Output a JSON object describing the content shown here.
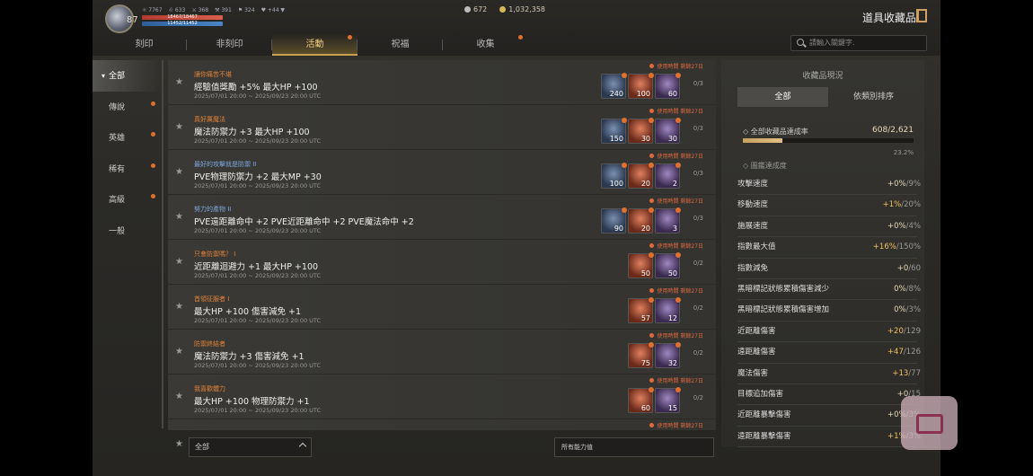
{
  "player": {
    "level": "87",
    "stats": [
      "⚛ 7767",
      "♌ 633",
      "⚔ 368",
      "⚒ 391",
      "⚑ 324",
      "♥ +44 ▼"
    ],
    "hp_text": "18467/18467",
    "mp_text": "11452/11452"
  },
  "currency": {
    "diamond": "672",
    "gold": "1,032,358",
    "diamond_color": "#bbbbbb",
    "gold_color": "#d6b85a"
  },
  "header": {
    "title": "道具收藏品"
  },
  "tabs": [
    {
      "label": "刻印",
      "active": false,
      "badge": false
    },
    {
      "label": "非刻印",
      "active": false,
      "badge": false
    },
    {
      "label": "活動",
      "active": true,
      "badge": true
    },
    {
      "label": "祝福",
      "active": false,
      "badge": false
    },
    {
      "label": "收集",
      "active": false,
      "badge": true
    }
  ],
  "search": {
    "placeholder": "請輸入關鍵字."
  },
  "sidebar": {
    "items": [
      {
        "label": "全部",
        "active": true,
        "badge": false
      },
      {
        "label": "傳說",
        "active": false,
        "badge": true
      },
      {
        "label": "英雄",
        "active": false,
        "badge": true
      },
      {
        "label": "稀有",
        "active": false,
        "badge": true
      },
      {
        "label": "高級",
        "active": false,
        "badge": true
      },
      {
        "label": "一般",
        "active": false,
        "badge": false
      }
    ]
  },
  "collections": [
    {
      "category": "讓你痛苦不堪",
      "cat_color": "orange",
      "desc": "經驗值獎勵 +5% 最大HP +100",
      "date": "2025/07/01 20:00 ~ 2025/09/23 20:00 UTC",
      "time": "使用時間 剩餘27日",
      "progress": "0/3",
      "items": [
        {
          "color": "blue",
          "num": "240"
        },
        {
          "color": "orange",
          "num": "100"
        },
        {
          "color": "purple",
          "num": "60"
        }
      ]
    },
    {
      "category": "真好厲魔法",
      "cat_color": "orange",
      "desc": "魔法防禦力 +3 最大HP +100",
      "date": "2025/07/01 20:00 ~ 2025/09/23 20:00 UTC",
      "time": "使用時間 剩餘27日",
      "progress": "0/3",
      "items": [
        {
          "color": "blue",
          "num": "150"
        },
        {
          "color": "orange",
          "num": "30"
        },
        {
          "color": "purple",
          "num": "30"
        }
      ]
    },
    {
      "category": "最好的攻擊就是防禦 II",
      "cat_color": "blue",
      "desc": "PVE物理防禦力 +2 最大MP +30",
      "date": "2025/07/01 20:00 ~ 2025/09/23 20:00 UTC",
      "time": "使用時間 剩餘27日",
      "progress": "0/3",
      "items": [
        {
          "color": "blue",
          "num": "100"
        },
        {
          "color": "orange",
          "num": "20"
        },
        {
          "color": "purple",
          "num": "2"
        }
      ]
    },
    {
      "category": "努力的產物 II",
      "cat_color": "blue",
      "desc": "PVE遠距離命中 +2 PVE近距離命中 +2 PVE魔法命中 +2",
      "date": "2025/07/01 20:00 ~ 2025/09/23 20:00 UTC",
      "time": "使用時間 剩餘27日",
      "progress": "0/3",
      "items": [
        {
          "color": "blue",
          "num": "90"
        },
        {
          "color": "orange",
          "num": "20"
        },
        {
          "color": "purple",
          "num": "3"
        }
      ]
    },
    {
      "category": "只會防禦嗎？ I",
      "cat_color": "orange",
      "desc": "近距離迴避力 +1 最大HP +100",
      "date": "2025/07/01 20:00 ~ 2025/09/23 20:00 UTC",
      "time": "使用時間 剩餘27日",
      "progress": "0/2",
      "items": [
        {
          "color": "orange",
          "num": "50"
        },
        {
          "color": "purple",
          "num": "50"
        }
      ]
    },
    {
      "category": "首領征服者 I",
      "cat_color": "orange",
      "desc": "最大HP +100 傷害減免 +1",
      "date": "2025/07/01 20:00 ~ 2025/09/23 20:00 UTC",
      "time": "使用時間 剩餘27日",
      "progress": "0/2",
      "items": [
        {
          "color": "orange",
          "num": "57"
        },
        {
          "color": "purple",
          "num": "12"
        }
      ]
    },
    {
      "category": "防禦終結者",
      "cat_color": "orange",
      "desc": "魔法防禦力 +3 傷害減免 +1",
      "date": "2025/07/01 20:00 ~ 2025/09/23 20:00 UTC",
      "time": "使用時間 剩餘27日",
      "progress": "0/2",
      "items": [
        {
          "color": "orange",
          "num": "75"
        },
        {
          "color": "purple",
          "num": "32"
        }
      ]
    },
    {
      "category": "我喜歡體力",
      "cat_color": "orange",
      "desc": "最大HP +100 物理防禦力 +1",
      "date": "2025/07/01 20:00 ~ 2025/09/23 20:00 UTC",
      "time": "使用時間 剩餘27日",
      "progress": "0/2",
      "items": [
        {
          "color": "orange",
          "num": "60"
        },
        {
          "color": "purple",
          "num": "15"
        }
      ]
    },
    {
      "category": "",
      "cat_color": "orange",
      "desc": "",
      "date": "",
      "time": "使用時間 剩餘27日",
      "progress": "",
      "items": []
    }
  ],
  "filter": {
    "selected": "全部"
  },
  "ability_filter": {
    "label": "所有能力值"
  },
  "panel": {
    "title": "收藏品現況",
    "tabs": [
      {
        "label": "全部",
        "active": true
      },
      {
        "label": "依類別排序",
        "active": false
      }
    ],
    "overall_label": "全部收藏品達成率",
    "overall_value": "608/2,621",
    "overall_fraction": 0.232,
    "overall_pct": "23.2%",
    "guide_label": "圖鑑達成度",
    "stats": [
      {
        "name": "攻擊速度",
        "cur": "+0%",
        "max": "9%",
        "hi": false
      },
      {
        "name": "移動速度",
        "cur": "+1%",
        "max": "20%",
        "hi": true
      },
      {
        "name": "施展速度",
        "cur": "+0%",
        "max": "4%",
        "hi": false
      },
      {
        "name": "指數最大值",
        "cur": "+16%",
        "max": "150%",
        "hi": true
      },
      {
        "name": "指數減免",
        "cur": "+0",
        "max": "60",
        "hi": false
      },
      {
        "name": "黑暗標記狀態累積傷害減少",
        "cur": "0%",
        "max": "8%",
        "hi": false
      },
      {
        "name": "黑暗標記狀態累積傷害增加",
        "cur": "0%",
        "max": "3%",
        "hi": false
      },
      {
        "name": "近距離傷害",
        "cur": "+20",
        "max": "129",
        "hi": true
      },
      {
        "name": "遠距離傷害",
        "cur": "+47",
        "max": "126",
        "hi": true
      },
      {
        "name": "魔法傷害",
        "cur": "+13",
        "max": "77",
        "hi": true
      },
      {
        "name": "目標追加傷害",
        "cur": "+0",
        "max": "15",
        "hi": false
      },
      {
        "name": "近距離暴擊傷害",
        "cur": "+0%",
        "max": "3%",
        "hi": false
      },
      {
        "name": "遠距離暴擊傷害",
        "cur": "+1%",
        "max": "3%",
        "hi": true
      }
    ]
  }
}
